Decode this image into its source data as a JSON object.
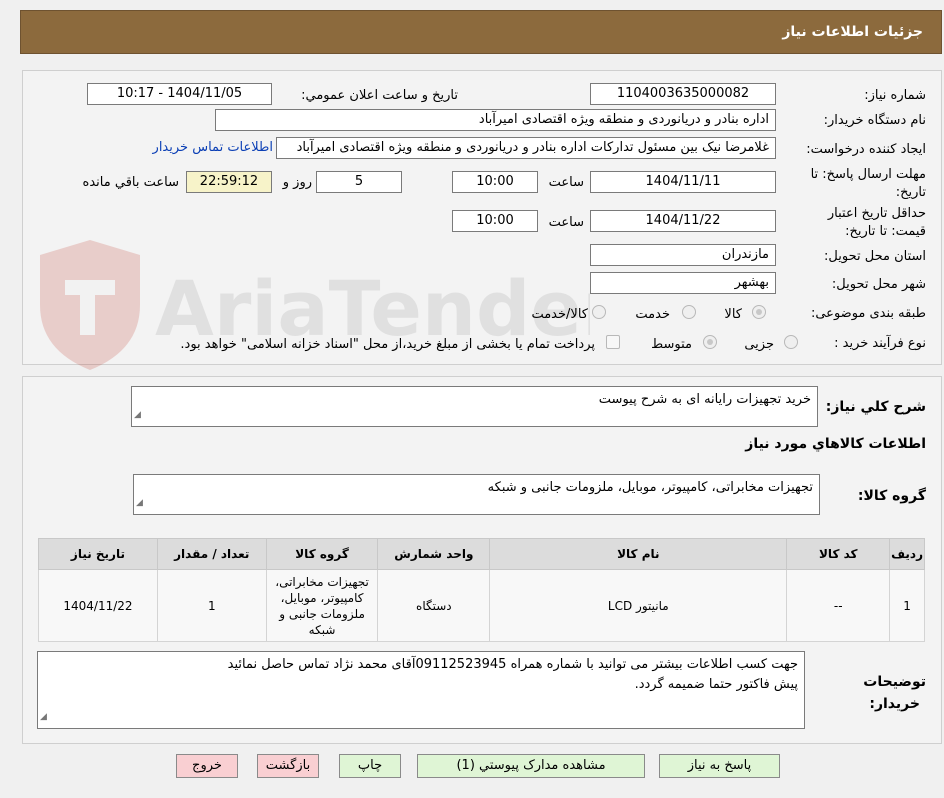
{
  "header": {
    "title": "جزئيات اطلاعات نياز"
  },
  "watermark": {
    "text": "AriaTender.neT"
  },
  "labels": {
    "need_number": "شماره نیاز:",
    "announce": "تاریخ و ساعت اعلان عمومي:",
    "buyer_name": "نام دستگاه خریدار:",
    "creator": "ایجاد کننده درخواست:",
    "send_deadline": "مهلت ارسال پاسخ: تا تاریخ:",
    "time": "ساعت",
    "days_and": "روز و",
    "remaining": "ساعت باقي مانده",
    "price_deadline": "حداقل تاریخ اعتبار قیمت: تا تاریخ:",
    "province": "استان محل تحویل:",
    "city": "شهر محل تحویل:",
    "category": "طبقه بندی موضوعی:",
    "process": "نوع فرآیند خرید :"
  },
  "fields": {
    "need_number": "1104003635000082",
    "announce_datetime": "1404/11/05 - 10:17",
    "buyer_name": "اداره بنادر و دریانوردی و منطقه ویژه اقتصادی امیرآباد",
    "creator": "غلامرضا نیک بین مسئول تدارکات اداره بنادر و دریانوردی و منطقه ویژه اقتصادی امیرآباد",
    "contact_link": "اطلاعات تماس خریدار",
    "send_date": "1404/11/11",
    "send_time": "10:00",
    "days": "5",
    "remaining_time": "22:59:12",
    "price_date": "1404/11/22",
    "price_time": "10:00",
    "province": "مازندران",
    "city": "بهشهر"
  },
  "category_options": [
    "کالا",
    "خدمت",
    "کالا/خدمت"
  ],
  "process_options": [
    "جزیی",
    "متوسط"
  ],
  "process_note": "پرداخت تمام یا بخشی از مبلغ خرید،از محل \"اسناد خزانه اسلامی\" خواهد بود.",
  "summary": {
    "label": "شرح کلي نياز:",
    "text": "خرید تجهیزات رایانه ای به شرح پیوست"
  },
  "goods_section": {
    "title": "اطلاعات کالاهاي مورد نياز",
    "group_label": "گروه کالا:",
    "group_text": "تجهیزات مخابراتی، کامپیوتر، موبایل، ملزومات جانبی و شبکه"
  },
  "table": {
    "headers": [
      "رديف",
      "کد کالا",
      "نام کالا",
      "واحد شمارش",
      "گروه کالا",
      "تعداد / مقدار",
      "تاریخ نیاز"
    ],
    "rows": [
      [
        "1",
        "--",
        "مانیتور LCD",
        "دستگاه",
        "تجهیزات مخابراتی، کامپیوتر، موبایل، ملزومات جانبی و شبکه",
        "1",
        "1404/11/22"
      ]
    ]
  },
  "buyer_notes": {
    "label_line1": "توضیحات",
    "label_line2": "خریدار:",
    "line1": "جهت کسب اطلاعات بیشتر می توانید با شماره همراه  09112523945آقای محمد نژاد تماس حاصل نمائید",
    "line2": "پیش فاکتور حتما ضمیمه گردد."
  },
  "buttons": {
    "reply": "پاسخ به نياز",
    "attachments": "مشاهده مدارک پيوستي (1)",
    "print": "چاپ",
    "back": "بازگشت",
    "exit": "خروج"
  },
  "colors": {
    "header": "#8c6a3d",
    "green_button": "#dff5d5",
    "pink_button": "#f9cfd2",
    "link": "#0b3fb5"
  }
}
